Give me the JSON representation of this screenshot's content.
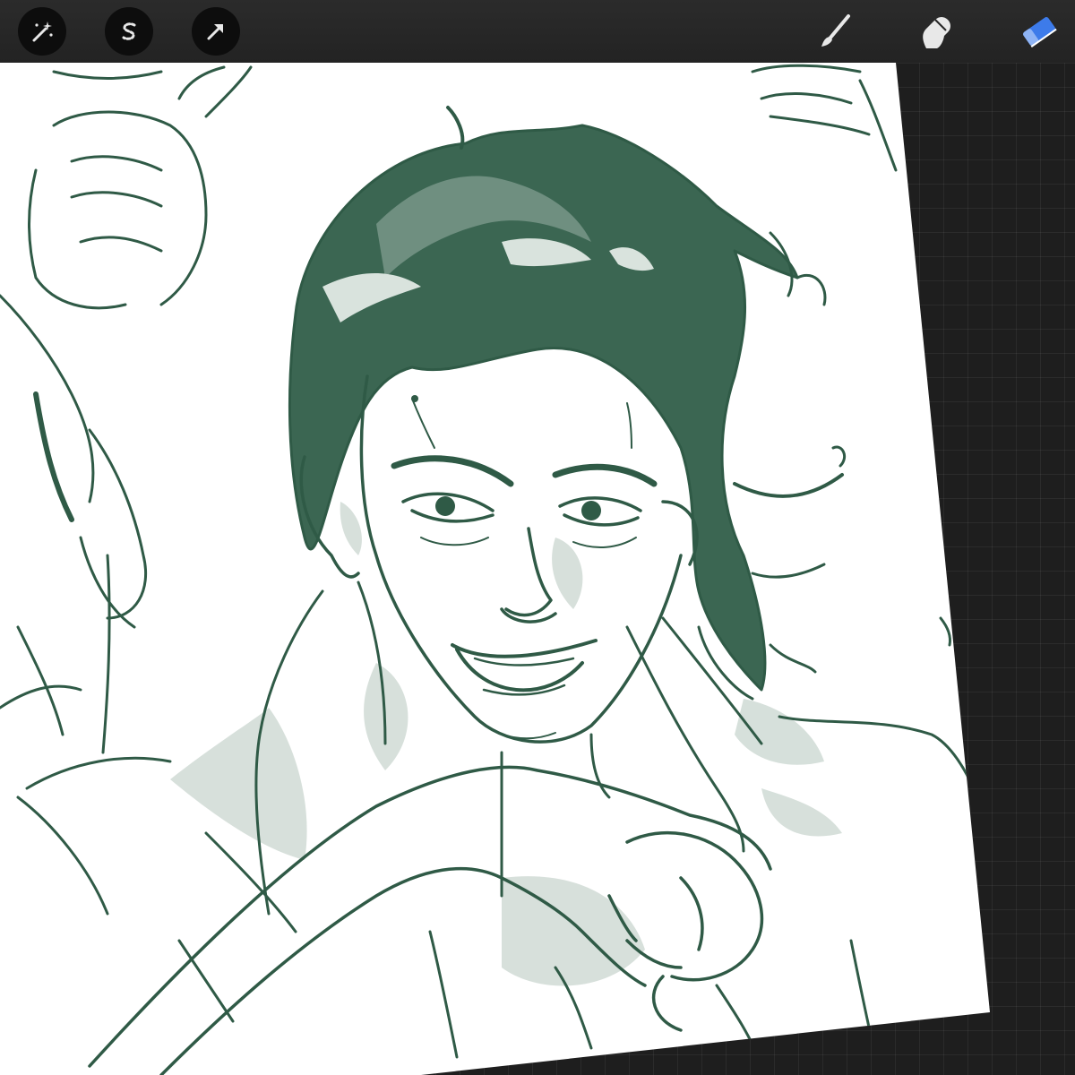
{
  "app": {
    "colors": {
      "toolbar": "#262626",
      "workspace": "#1e1e1e",
      "paper": "#ffffff",
      "ink": "#2f5a46",
      "ink_light": "#9bb2a6",
      "active_tool": "#3d7bea",
      "icon": "#e8e8e8"
    }
  },
  "toolbar": {
    "left_tools": [
      {
        "id": "adjustments",
        "icon": "magic-wand-icon"
      },
      {
        "id": "selection",
        "icon": "selection-s-icon"
      },
      {
        "id": "transform",
        "icon": "arrow-cursor-icon"
      }
    ],
    "right_tools": [
      {
        "id": "brush",
        "icon": "brush-icon",
        "active": false
      },
      {
        "id": "smudge",
        "icon": "smudge-finger-icon",
        "active": false
      },
      {
        "id": "eraser",
        "icon": "eraser-icon",
        "active": true
      }
    ]
  },
  "canvas": {
    "content": "sketch-artwork",
    "ink_color": "#2f5a46"
  }
}
